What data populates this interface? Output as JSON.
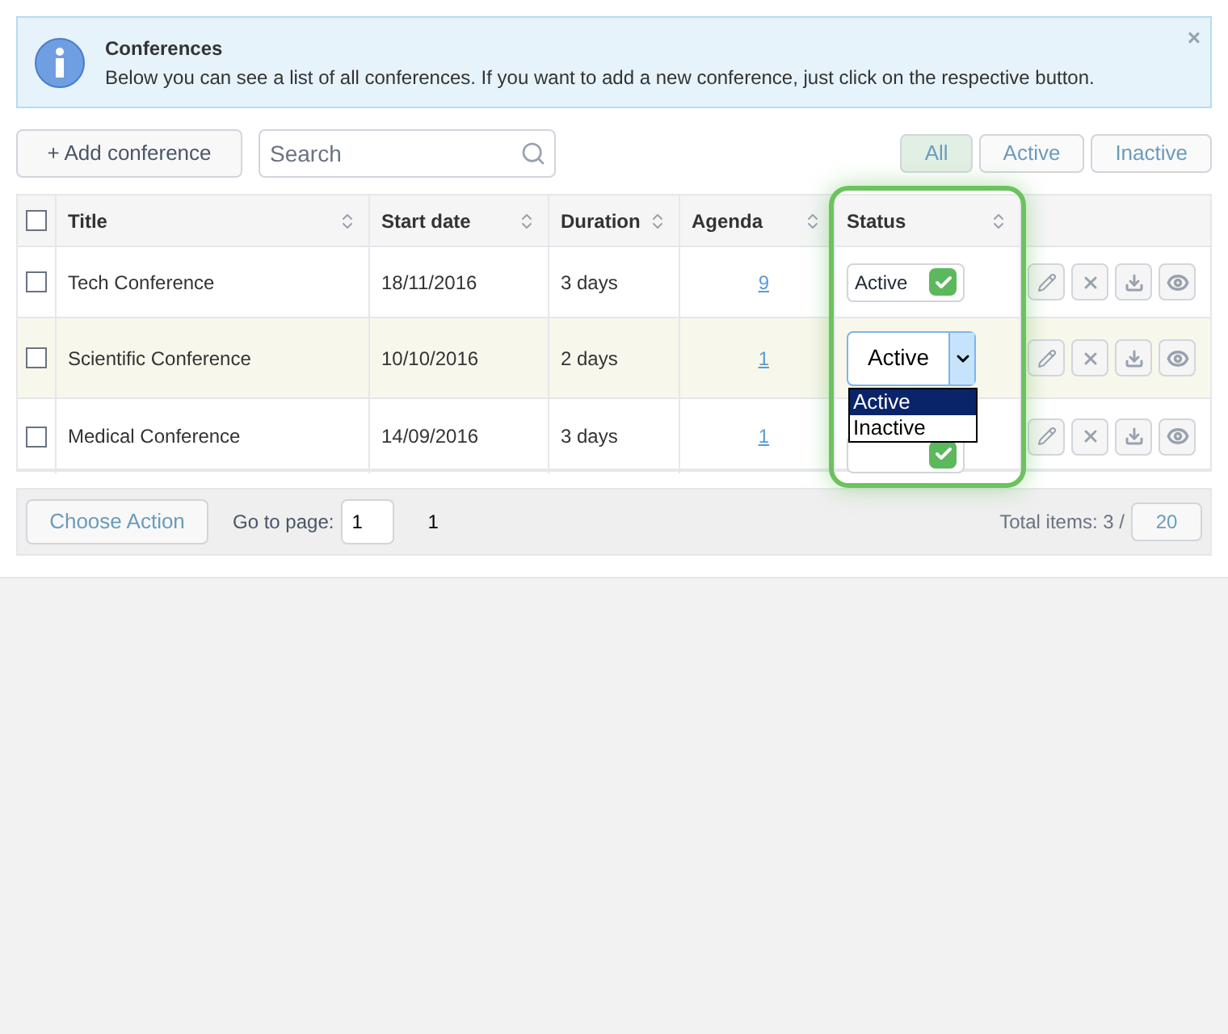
{
  "alert": {
    "title": "Conferences",
    "message": "Below you can see a list of all conferences. If you want to add a new conference, just click on the respective button.",
    "close": "×"
  },
  "toolbar": {
    "add_button": "+ Add conference",
    "search": {
      "placeholder": "Search"
    },
    "filters": [
      {
        "label": "All",
        "selected": true
      },
      {
        "label": "Active",
        "selected": false
      },
      {
        "label": "Inactive",
        "selected": false
      }
    ]
  },
  "table": {
    "select_all_checked": false,
    "columns": [
      {
        "label": "Title"
      },
      {
        "label": "Start date"
      },
      {
        "label": "Duration"
      },
      {
        "label": "Agenda"
      },
      {
        "label": "Status"
      }
    ],
    "rows": [
      {
        "checked": false,
        "highlighted": false,
        "title": "Tech Conference",
        "start_date": "18/11/2016",
        "duration": "3 days",
        "agenda": "9",
        "status": {
          "kind": "toggle",
          "label": "Active",
          "active": true
        }
      },
      {
        "checked": false,
        "highlighted": true,
        "title": "Scientific Conference",
        "start_date": "10/10/2016",
        "duration": "2 days",
        "agenda": "1",
        "status": {
          "kind": "select",
          "value": "Active",
          "open": true,
          "options": [
            {
              "label": "Active",
              "selected": true
            },
            {
              "label": "Inactive",
              "selected": false
            }
          ]
        }
      },
      {
        "checked": false,
        "highlighted": false,
        "title": "Medical Conference",
        "start_date": "14/09/2016",
        "duration": "3 days",
        "agenda": "1",
        "status": {
          "kind": "toggle",
          "active": true
        }
      }
    ]
  },
  "footer": {
    "action_button": "Choose Action",
    "goto_label": "Go to page:",
    "page_value": "1",
    "page_number": "1",
    "total_label": "Total items: 3 /",
    "page_size": "20"
  }
}
